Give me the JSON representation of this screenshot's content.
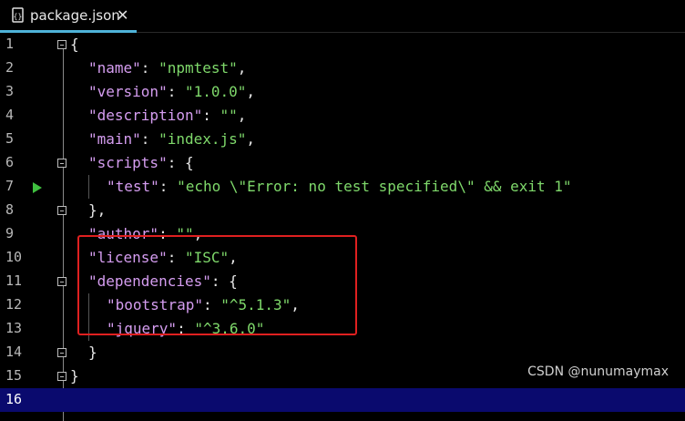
{
  "tab": {
    "title": "package.json",
    "close": "✕",
    "accent": "#4fb3d9"
  },
  "editor": {
    "current_line": "16",
    "lines": [
      {
        "n": "1",
        "parts": [
          [
            "p",
            "{"
          ]
        ]
      },
      {
        "n": "2",
        "parts": [
          [
            "k",
            "\"name\""
          ],
          [
            "p",
            ": "
          ],
          [
            "s",
            "\"npmtest\""
          ],
          [
            "p",
            ","
          ]
        ]
      },
      {
        "n": "3",
        "parts": [
          [
            "k",
            "\"version\""
          ],
          [
            "p",
            ": "
          ],
          [
            "s",
            "\"1.0.0\""
          ],
          [
            "p",
            ","
          ]
        ]
      },
      {
        "n": "4",
        "parts": [
          [
            "k",
            "\"description\""
          ],
          [
            "p",
            ": "
          ],
          [
            "s",
            "\"\""
          ],
          [
            "p",
            ","
          ]
        ]
      },
      {
        "n": "5",
        "parts": [
          [
            "k",
            "\"main\""
          ],
          [
            "p",
            ": "
          ],
          [
            "s",
            "\"index.js\""
          ],
          [
            "p",
            ","
          ]
        ]
      },
      {
        "n": "6",
        "parts": [
          [
            "k",
            "\"scripts\""
          ],
          [
            "p",
            ": {"
          ]
        ]
      },
      {
        "n": "7",
        "parts": [
          [
            "k",
            "\"test\""
          ],
          [
            "p",
            ": "
          ],
          [
            "s",
            "\"echo \\\"Error: no test specified\\\" && exit 1\""
          ]
        ]
      },
      {
        "n": "8",
        "parts": [
          [
            "p",
            "},"
          ]
        ]
      },
      {
        "n": "9",
        "parts": [
          [
            "k",
            "\"author\""
          ],
          [
            "p",
            ": "
          ],
          [
            "s",
            "\"\""
          ],
          [
            "p",
            ","
          ]
        ]
      },
      {
        "n": "10",
        "parts": [
          [
            "k",
            "\"license\""
          ],
          [
            "p",
            ": "
          ],
          [
            "s",
            "\"ISC\""
          ],
          [
            "p",
            ","
          ]
        ]
      },
      {
        "n": "11",
        "parts": [
          [
            "k",
            "\"dependencies\""
          ],
          [
            "p",
            ": {"
          ]
        ]
      },
      {
        "n": "12",
        "parts": [
          [
            "k",
            "\"bootstrap\""
          ],
          [
            "p",
            ": "
          ],
          [
            "s",
            "\"^5.1.3\""
          ],
          [
            "p",
            ","
          ]
        ]
      },
      {
        "n": "13",
        "parts": [
          [
            "k",
            "\"jquery\""
          ],
          [
            "p",
            ": "
          ],
          [
            "s",
            "\"^3.6.0\""
          ]
        ]
      },
      {
        "n": "14",
        "parts": [
          [
            "p",
            "}"
          ]
        ]
      },
      {
        "n": "15",
        "parts": [
          [
            "p",
            "}"
          ]
        ]
      },
      {
        "n": "16",
        "parts": []
      }
    ]
  },
  "colors": {
    "key": "#d59df0",
    "string": "#7fd96b",
    "punct": "#e6e6e6",
    "current_line_bg": "#0a0a6e",
    "highlight_border": "#e02020"
  },
  "watermark": "CSDN @nunumaymax"
}
